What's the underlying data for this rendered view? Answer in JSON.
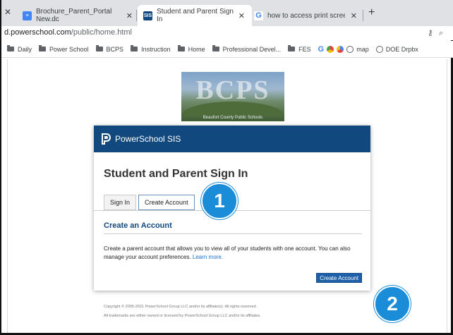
{
  "browser": {
    "tabs": [
      {
        "title": "Brochure_Parent_Portal New.dc",
        "icon": "docs-icon"
      },
      {
        "title": "Student and Parent Sign In",
        "icon": "powerschool-favicon"
      },
      {
        "title": "how to access print screen on c",
        "icon": "google-icon"
      }
    ],
    "favicon_text": "SIS",
    "url_host": "d.powerschool.com",
    "url_path": "/public/home.html",
    "bookmarks": [
      {
        "label": "Daily",
        "icon": "folder"
      },
      {
        "label": "Power School",
        "icon": "folder"
      },
      {
        "label": "BCPS",
        "icon": "folder"
      },
      {
        "label": "Instruction",
        "icon": "folder"
      },
      {
        "label": "Home",
        "icon": "folder"
      },
      {
        "label": "Professional Devel...",
        "icon": "folder"
      },
      {
        "label": "FES",
        "icon": "folder"
      },
      {
        "label": "map",
        "icon": "globe"
      },
      {
        "label": "DOE Drpbx",
        "icon": "globe"
      }
    ]
  },
  "banner": {
    "logo": "BCPS",
    "subtitle": "Beaufort County Public Schools"
  },
  "card": {
    "brand": "PowerSchool SIS",
    "title": "Student and Parent Sign In",
    "tab_signin": "Sign In",
    "tab_create": "Create Account",
    "section_title": "Create an Account",
    "description": "Create a parent account that allows you to view all of your students with one account. You can also manage your account preferences.",
    "learn_more": "Learn more.",
    "create_button": "Create Account"
  },
  "footer": {
    "copyright": "Copyright © 2005-2021 PowerSchool Group LLC and/or its affiliate(s). All rights reserved.",
    "trademarks": "All trademarks are either owned or licensed by PowerSchool Group LLC and/or its affiliates."
  },
  "annotations": {
    "step1": "1",
    "step2": "2"
  },
  "colors": {
    "header": "#11497f",
    "badge": "#1b8cd8",
    "button": "#1d5fa8"
  }
}
